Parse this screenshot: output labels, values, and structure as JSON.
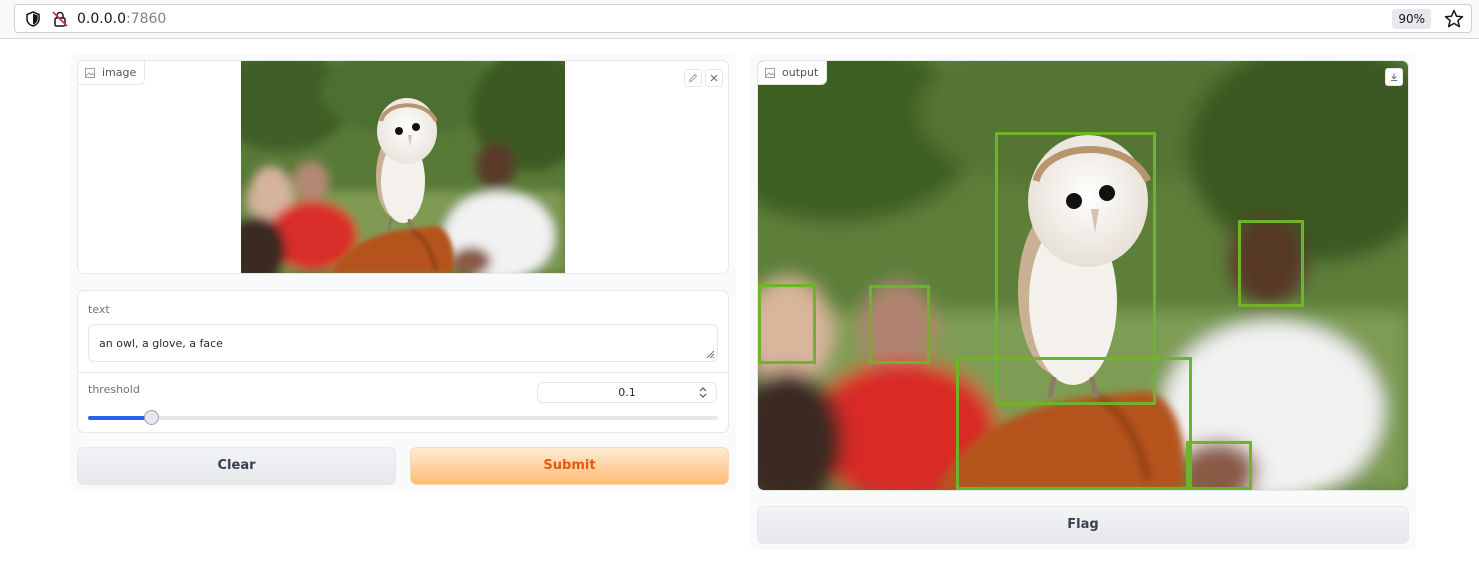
{
  "browser": {
    "url_host": "0.0.0.0",
    "url_port": ":7860",
    "zoom": "90%"
  },
  "inputs": {
    "image_label": "image",
    "text_label": "text",
    "text_value": "an owl, a glove, a face",
    "threshold_label": "threshold",
    "threshold_value": "0.1",
    "threshold_fraction": 0.1
  },
  "buttons": {
    "clear": "Clear",
    "submit": "Submit",
    "flag": "Flag"
  },
  "output": {
    "label": "output",
    "detections": [
      {
        "label": "an owl"
      },
      {
        "label": "a glove"
      },
      {
        "label": "a face"
      },
      {
        "label": "a face"
      },
      {
        "label": "a face"
      },
      {
        "label": "a face"
      }
    ]
  },
  "colors": {
    "box": "#6fb32a",
    "submit_text": "#ea580c",
    "slider_fill": "#2563eb"
  }
}
